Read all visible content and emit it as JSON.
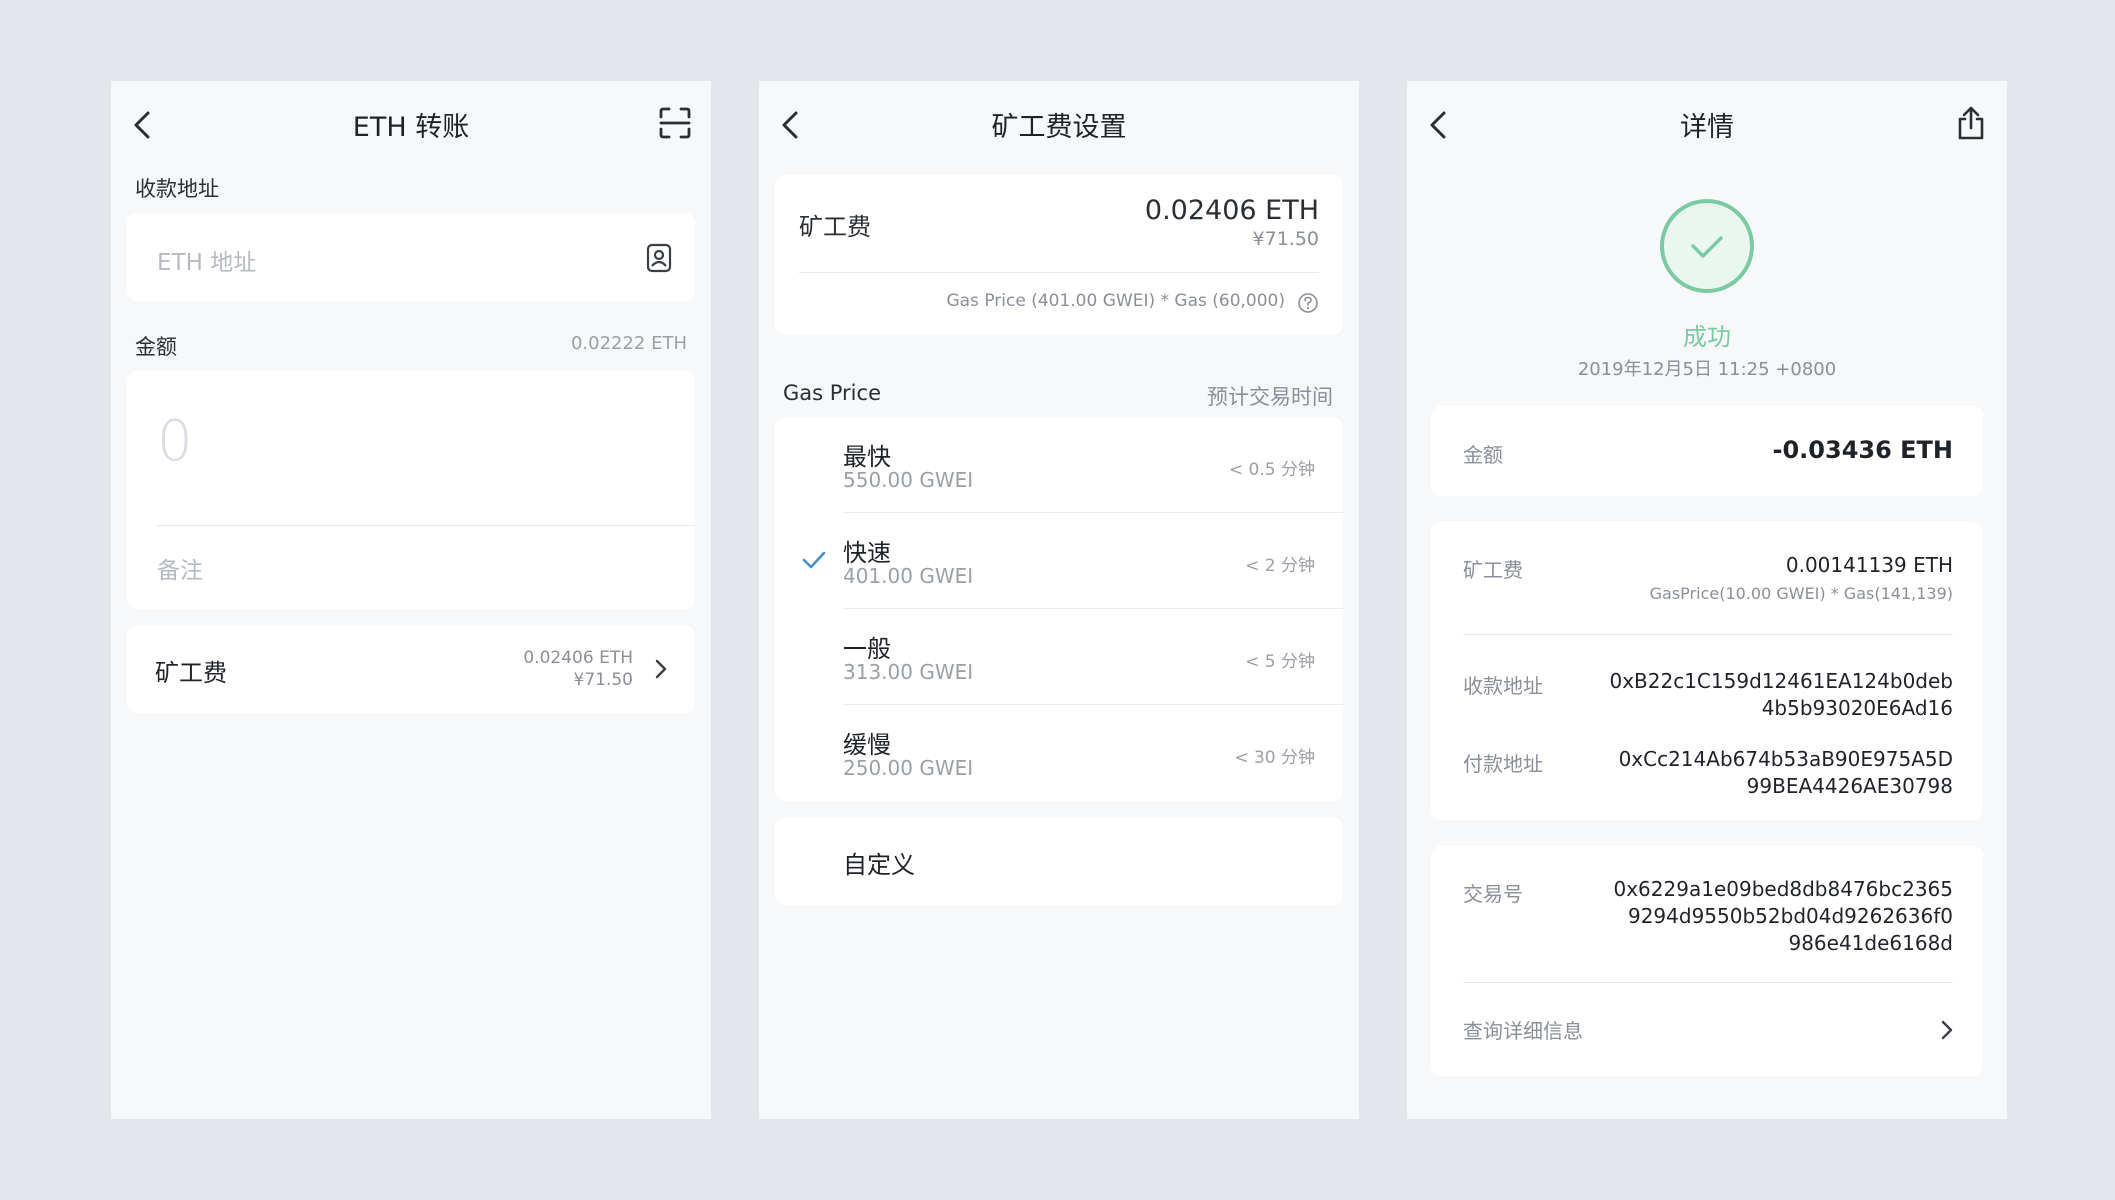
{
  "transfer": {
    "title": "ETH 转账",
    "address_label": "收款地址",
    "address_placeholder": "ETH 地址",
    "amount_label": "金额",
    "balance": "0.02222 ETH",
    "amount_placeholder": "0",
    "memo_placeholder": "备注",
    "fee_label": "矿工费",
    "fee_eth": "0.02406 ETH",
    "fee_cny": "¥71.50"
  },
  "fee_settings": {
    "title": "矿工费设置",
    "fee_label": "矿工费",
    "fee_eth": "0.02406 ETH",
    "fee_cny": "¥71.50",
    "formula": "Gas Price (401.00 GWEI) * Gas (60,000)",
    "gas_price_header": "Gas Price",
    "time_header": "预计交易时间",
    "options": [
      {
        "name": "最快",
        "gwei": "550.00 GWEI",
        "time": "< 0.5 分钟",
        "selected": false
      },
      {
        "name": "快速",
        "gwei": "401.00 GWEI",
        "time": "< 2 分钟",
        "selected": true
      },
      {
        "name": "一般",
        "gwei": "313.00 GWEI",
        "time": "< 5 分钟",
        "selected": false
      },
      {
        "name": "缓慢",
        "gwei": "250.00 GWEI",
        "time": "< 30 分钟",
        "selected": false
      }
    ],
    "custom_label": "自定义"
  },
  "detail": {
    "title": "详情",
    "status": "成功",
    "datetime": "2019年12月5日 11:25 +0800",
    "amount_label": "金额",
    "amount_value": "-0.03436 ETH",
    "fee_label": "矿工费",
    "fee_value": "0.00141139 ETH",
    "fee_formula": "GasPrice(10.00 GWEI) * Gas(141,139)",
    "to_label": "收款地址",
    "to_line1": "0xB22c1C159d12461EA124b0deb",
    "to_line2": "4b5b93020E6Ad16",
    "from_label": "付款地址",
    "from_line1": "0xCc214Ab674b53aB90E975A5D",
    "from_line2": "99BEA4426AE30798",
    "tx_label": "交易号",
    "tx_line1": "0x6229a1e09bed8db8476bc2365",
    "tx_line2": "9294d9550b52bd04d9262636f0",
    "tx_line3": "986e41de6168d",
    "more_label": "查询详细信息"
  },
  "colors": {
    "background": "#e3e7ec",
    "screen": "#f7f8fa",
    "card": "#ffffff",
    "success": "#7ccaa1",
    "check": "#4a90c8"
  }
}
